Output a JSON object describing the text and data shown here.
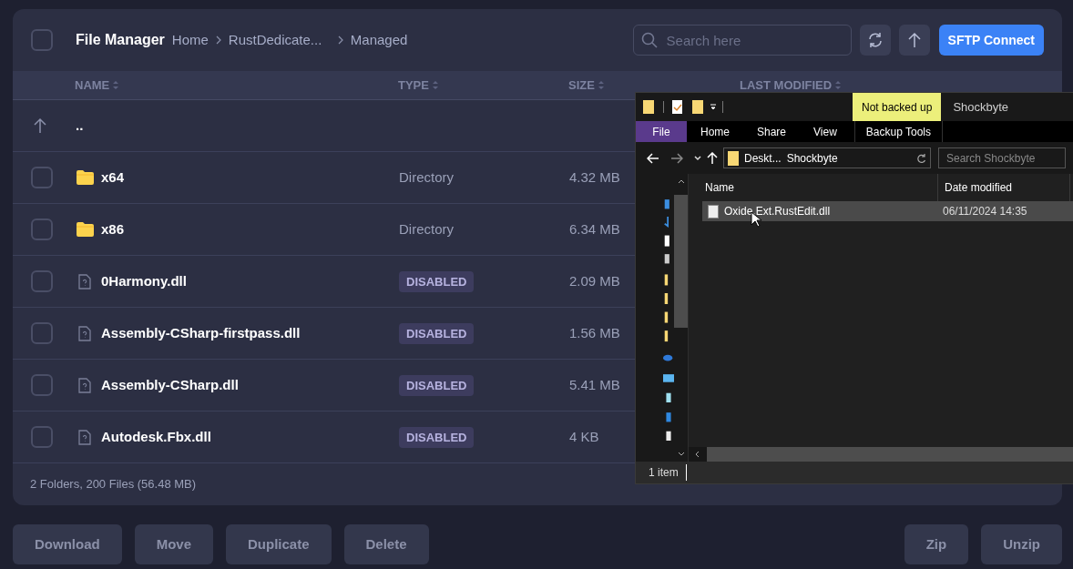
{
  "header": {
    "select_all": {
      "checked": false
    },
    "title": "File Manager",
    "breadcrumbs": [
      "Home",
      "RustDedicate...",
      "Managed"
    ],
    "search": {
      "placeholder": "Search here"
    },
    "connect_button": "SFTP Connect"
  },
  "table": {
    "columns": [
      "NAME",
      "TYPE",
      "SIZE",
      "LAST MODIFIED"
    ],
    "parent_row": "..",
    "rows": [
      {
        "kind": "folder",
        "name": "x64",
        "type": "Directory",
        "size": "4.32 MB",
        "checked": false
      },
      {
        "kind": "folder",
        "name": "x86",
        "type": "Directory",
        "size": "6.34 MB",
        "checked": false
      },
      {
        "kind": "file",
        "name": "0Harmony.dll",
        "type": "DISABLED",
        "size": "2.09 MB",
        "checked": false
      },
      {
        "kind": "file",
        "name": "Assembly-CSharp-firstpass.dll",
        "type": "DISABLED",
        "size": "1.56 MB",
        "checked": false
      },
      {
        "kind": "file",
        "name": "Assembly-CSharp.dll",
        "type": "DISABLED",
        "size": "5.41 MB",
        "checked": false
      },
      {
        "kind": "file",
        "name": "Autodesk.Fbx.dll",
        "type": "DISABLED",
        "size": "4 KB",
        "checked": false
      }
    ],
    "summary": "2 Folders, 200 Files (56.48 MB)"
  },
  "explorer": {
    "context_tab": "Not backed up",
    "title": "Shockbyte",
    "ribbon_tabs": [
      {
        "label": "File",
        "kind": "file_menu"
      },
      {
        "label": "Home",
        "kind": "tab"
      },
      {
        "label": "Share",
        "kind": "tab"
      },
      {
        "label": "View",
        "kind": "tab"
      },
      {
        "label": "Backup Tools",
        "kind": "context"
      }
    ],
    "address": [
      "Deskt...",
      "Shockbyte"
    ],
    "search": {
      "placeholder": "Search Shockbyte"
    },
    "columns": [
      "Name",
      "Date modified"
    ],
    "files": [
      {
        "name": "Oxide.Ext.RustEdit.dll",
        "date": "06/11/2024 14:35",
        "selected": true
      }
    ],
    "status": "1 item"
  },
  "actions_left": [
    "Download",
    "Move",
    "Duplicate",
    "Delete"
  ],
  "actions_right": [
    "Zip",
    "Unzip"
  ]
}
